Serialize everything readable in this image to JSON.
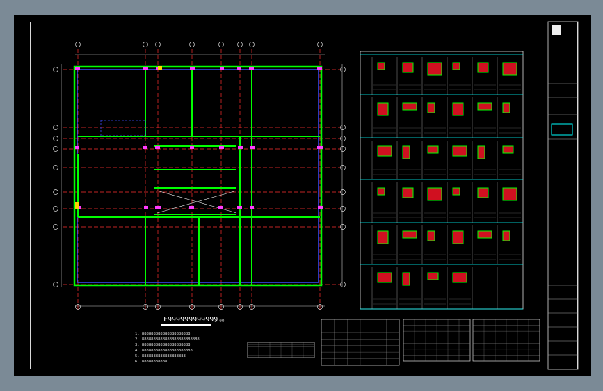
{
  "drawing": {
    "plan_title": "F999999999999",
    "plan_scale": "1:00",
    "notes": [
      "1. 888888888888888888888",
      "2. 8888888888888888888888888",
      "3. 888888888888888888888",
      "4. 8888888888888888888888",
      "5. 8888888888888888888",
      "6. 88888888888"
    ]
  },
  "colors": {
    "frame": "#7b8a96",
    "paper": "#000000",
    "grid": "#ff3030",
    "wall": "#00ff00",
    "column": "#ff3cff",
    "text": "#ffffff",
    "accent": "#ffd200",
    "cyan": "#00ffff"
  }
}
